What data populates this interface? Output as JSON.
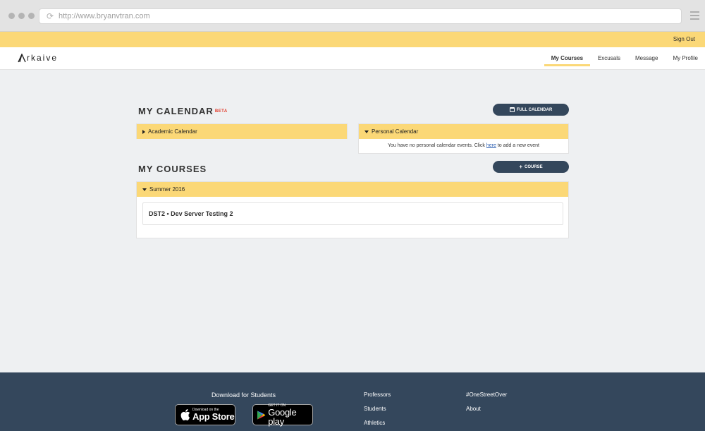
{
  "browser": {
    "url": "http://www.bryanvtran.com"
  },
  "topbar": {
    "sign_out": "Sign Out"
  },
  "navbar": {
    "logo_text": "rkaive",
    "items": [
      {
        "label": "My Courses",
        "active": true
      },
      {
        "label": "Excusals"
      },
      {
        "label": "Message"
      },
      {
        "label": "My Profile"
      }
    ]
  },
  "calendar": {
    "title": "MY CALENDAR",
    "beta": "BETA",
    "full_calendar_label": "FULL CALENDAR",
    "academic_label": "Academic Calendar",
    "personal_label": "Personal Calendar",
    "personal_msg_before": "You have no personal calendar events. Click ",
    "personal_msg_link": "here",
    "personal_msg_after": " to add a new event"
  },
  "courses": {
    "title": "MY COURSES",
    "add_course_label": "COURSE",
    "term": "Summer 2016",
    "items": [
      {
        "label": "DST2 • Dev Server Testing 2"
      }
    ]
  },
  "footer": {
    "download_heading": "Download for Students",
    "app_store": {
      "small": "Download on the",
      "big": "App Store"
    },
    "google_play": {
      "small": "GET IT ON",
      "big": "Google play"
    },
    "col1": [
      "Professors",
      "Students",
      "Athletics"
    ],
    "col2": [
      "#OneStreetOver",
      "About"
    ]
  },
  "colors": {
    "accent_yellow": "#fbd877",
    "navy": "#34475c",
    "beta_red": "#e23b2b"
  }
}
